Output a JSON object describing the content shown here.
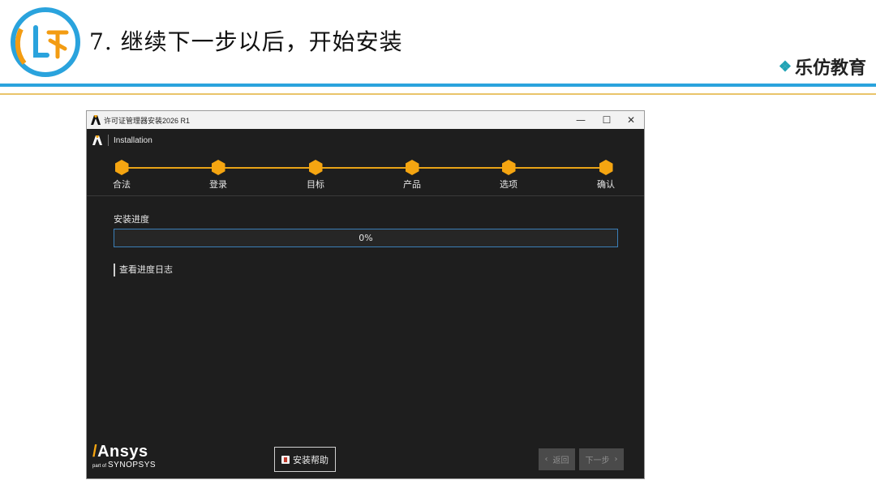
{
  "slide": {
    "title": "7. 继续下一步以后，开始安装",
    "brand": "乐仿教育",
    "brand_icon": "diamond-cluster-icon",
    "colors": {
      "accent_blue": "#2aa3dd",
      "accent_gold": "#e9c46a",
      "logo_orange": "#f39c12"
    }
  },
  "window": {
    "title": "许可证管理器安装2026 R1",
    "controls": {
      "minimize": "—",
      "maximize": "☐",
      "close": "✕"
    },
    "header_title": "Installation",
    "steps": [
      {
        "label": "合法"
      },
      {
        "label": "登录"
      },
      {
        "label": "目标"
      },
      {
        "label": "产品"
      },
      {
        "label": "选项"
      },
      {
        "label": "确认"
      }
    ],
    "progress": {
      "label": "安装进度",
      "percent_text": "0%",
      "fraction": 0
    },
    "log_link": "查看进度日志",
    "footer": {
      "logo_main": "Ansys",
      "logo_sub_prefix": "part of",
      "logo_sub": "SYNOPSYS",
      "help_button": "安装帮助",
      "back_button": "返回",
      "next_button": "下一步"
    },
    "colors": {
      "accent": "#f5a511",
      "progress_border": "#3b7fb8",
      "background": "#1e1e1e"
    }
  }
}
